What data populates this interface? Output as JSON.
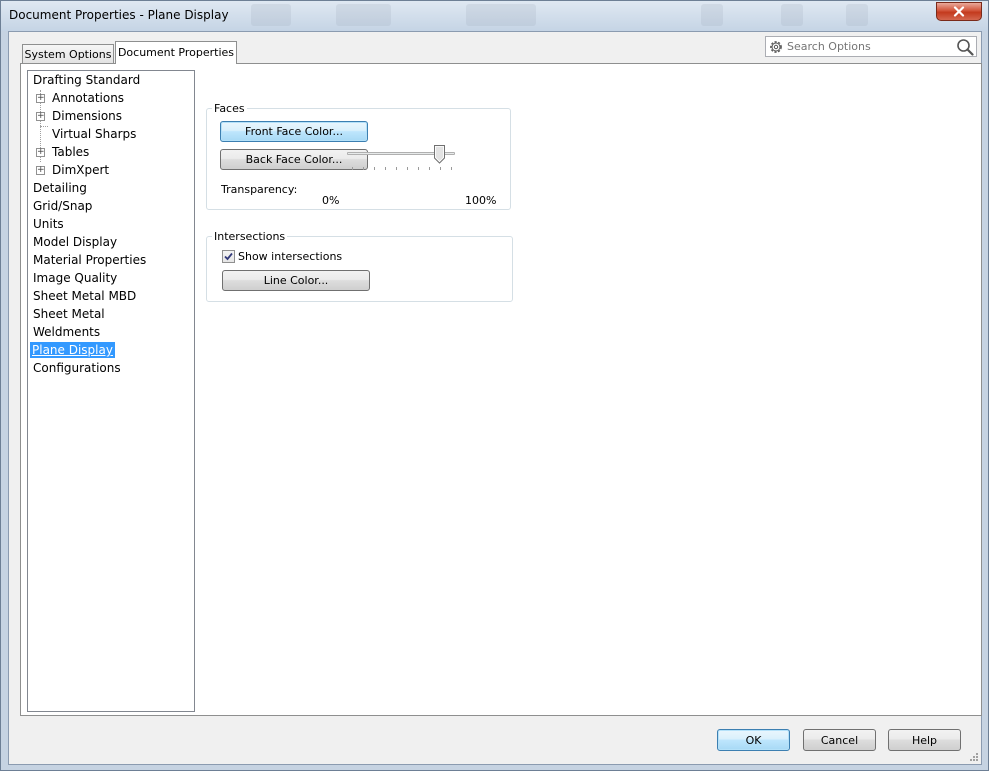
{
  "window": {
    "title": "Document Properties - Plane Display",
    "close_icon": "close-icon"
  },
  "tabs": [
    {
      "label": "System Options",
      "active": false
    },
    {
      "label": "Document Properties",
      "active": true
    }
  ],
  "search": {
    "placeholder": "Search Options",
    "value": ""
  },
  "tree": {
    "items": [
      {
        "label": "Drafting Standard",
        "level": 0,
        "expandable": false,
        "selected": false
      },
      {
        "label": "Annotations",
        "level": 1,
        "expandable": true,
        "selected": false
      },
      {
        "label": "Dimensions",
        "level": 1,
        "expandable": true,
        "selected": false
      },
      {
        "label": "Virtual Sharps",
        "level": 1,
        "expandable": false,
        "selected": false
      },
      {
        "label": "Tables",
        "level": 1,
        "expandable": true,
        "selected": false
      },
      {
        "label": "DimXpert",
        "level": 1,
        "expandable": true,
        "selected": false
      },
      {
        "label": "Detailing",
        "level": 0,
        "expandable": false,
        "selected": false
      },
      {
        "label": "Grid/Snap",
        "level": 0,
        "expandable": false,
        "selected": false
      },
      {
        "label": "Units",
        "level": 0,
        "expandable": false,
        "selected": false
      },
      {
        "label": "Model Display",
        "level": 0,
        "expandable": false,
        "selected": false
      },
      {
        "label": "Material Properties",
        "level": 0,
        "expandable": false,
        "selected": false
      },
      {
        "label": "Image Quality",
        "level": 0,
        "expandable": false,
        "selected": false
      },
      {
        "label": "Sheet Metal MBD",
        "level": 0,
        "expandable": false,
        "selected": false
      },
      {
        "label": "Sheet Metal",
        "level": 0,
        "expandable": false,
        "selected": false
      },
      {
        "label": "Weldments",
        "level": 0,
        "expandable": false,
        "selected": false
      },
      {
        "label": "Plane Display",
        "level": 0,
        "expandable": false,
        "selected": true
      },
      {
        "label": "Configurations",
        "level": 0,
        "expandable": false,
        "selected": false
      }
    ]
  },
  "faces": {
    "title": "Faces",
    "front_face_button": "Front Face Color...",
    "back_face_button": "Back Face Color...",
    "transparency_label": "Transparency:",
    "min_label": "0%",
    "max_label": "100%",
    "transparency_value_percent": 90
  },
  "intersections": {
    "title": "Intersections",
    "show_intersections_label": "Show intersections",
    "show_intersections_checked": true,
    "line_color_button": "Line Color..."
  },
  "footer": {
    "ok_label": "OK",
    "cancel_label": "Cancel",
    "help_label": "Help"
  },
  "colors": {
    "selection": "#3399ff",
    "focus_button": "#a7d9f5",
    "close_button": "#c33a1e"
  }
}
